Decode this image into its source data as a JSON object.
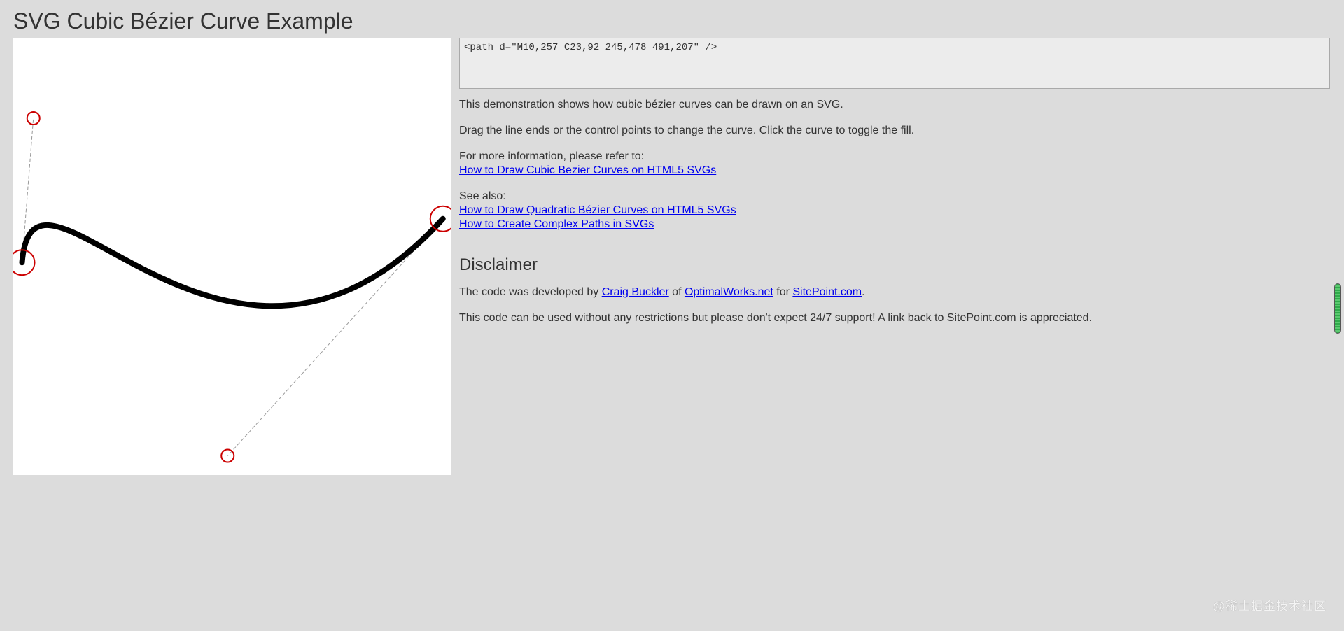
{
  "page": {
    "title": "SVG Cubic Bézier Curve Example"
  },
  "code": {
    "path_text": "<path d=\"M10,257 C23,92 245,478 491,207\" />"
  },
  "curve": {
    "p1": [
      10,
      257
    ],
    "c1": [
      23,
      92
    ],
    "c2": [
      245,
      478
    ],
    "p2": [
      491,
      207
    ],
    "stroke_color": "#000000",
    "control_color": "#cc0000"
  },
  "content": {
    "intro": "This demonstration shows how cubic bézier curves can be drawn on an SVG.",
    "instructions": "Drag the line ends or the control points to change the curve. Click the curve to toggle the fill.",
    "more_info_label": "For more information, please refer to:",
    "more_info_link": "How to Draw Cubic Bezier Curves on HTML5 SVGs",
    "see_also_label": "See also:",
    "see_also_links": [
      "How to Draw Quadratic Bézier Curves on HTML5 SVGs",
      "How to Create Complex Paths in SVGs"
    ],
    "disclaimer_heading": "Disclaimer",
    "credit_prefix": "The code was developed by ",
    "credit_author": "Craig Buckler",
    "credit_of": " of ",
    "credit_company": "OptimalWorks.net",
    "credit_for": " for ",
    "credit_site": "SitePoint.com",
    "credit_suffix": ".",
    "license": "This code can be used without any restrictions but please don't expect 24/7 support! A link back to SitePoint.com is appreciated."
  },
  "watermark": {
    "text": "@稀土掘金技术社区"
  }
}
